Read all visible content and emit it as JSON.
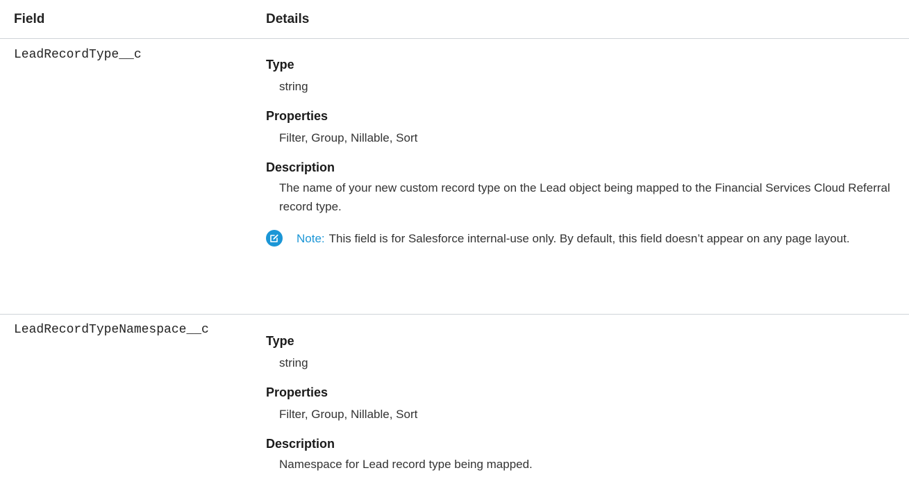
{
  "table": {
    "headers": {
      "field": "Field",
      "details": "Details"
    },
    "rows": [
      {
        "field": "LeadRecordType__c",
        "type_label": "Type",
        "type_value": "string",
        "properties_label": "Properties",
        "properties_value": "Filter, Group, Nillable, Sort",
        "description_label": "Description",
        "description_value": "The name of your new custom record type on the Lead object being mapped to the Financial Services Cloud Referral record type.",
        "note_label": "Note:",
        "note_text": "This field is for Salesforce internal-use only. By default, this field doesn’t appear on any page layout."
      },
      {
        "field": "LeadRecordTypeNamespace__c",
        "type_label": "Type",
        "type_value": "string",
        "properties_label": "Properties",
        "properties_value": "Filter, Group, Nillable, Sort",
        "description_label": "Description",
        "description_value": "Namespace for Lead record type being mapped."
      }
    ]
  },
  "colors": {
    "note_accent": "#1b96d6",
    "divider": "#cfd3d8"
  },
  "icons": {
    "note": "edit-note-icon"
  }
}
